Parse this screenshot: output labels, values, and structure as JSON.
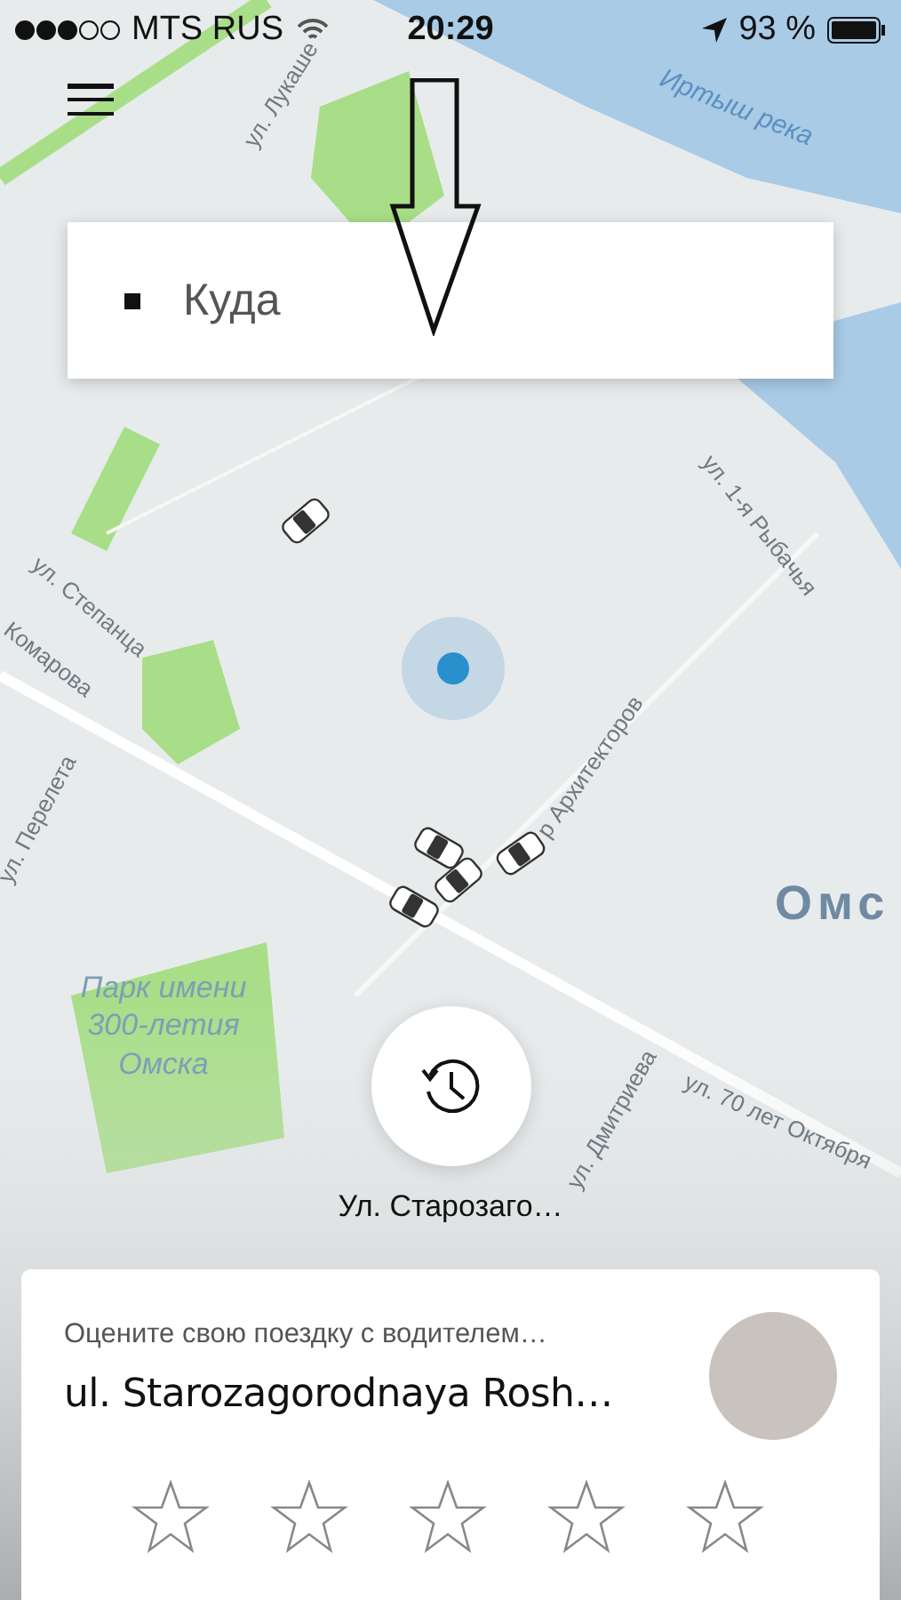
{
  "status_bar": {
    "carrier": "MTS RUS",
    "time": "20:29",
    "battery": "93 %"
  },
  "map": {
    "labels": [
      {
        "text": "ул. Лукаше",
        "kind": "street"
      },
      {
        "text": "Иртыш река",
        "kind": "water"
      },
      {
        "text": "ул. 1-я Рыбачья",
        "kind": "street"
      },
      {
        "text": "ул. Степанца",
        "kind": "street"
      },
      {
        "text": "Комарова",
        "kind": "street"
      },
      {
        "text": "ул. Перелета",
        "kind": "street"
      },
      {
        "text": "р Архитекторов",
        "kind": "street"
      },
      {
        "text": "Омс",
        "kind": "city"
      },
      {
        "text": "Парк имени 300-летия Омска",
        "kind": "park"
      },
      {
        "text": "ул. 70 лет Октября",
        "kind": "street"
      },
      {
        "text": "ул. Дмитриева",
        "kind": "street"
      }
    ]
  },
  "search": {
    "label": "Куда"
  },
  "recent_place": {
    "label": "Ул. Старозаго…"
  },
  "rating_card": {
    "prompt": "Оцените свою поездку с водителем…",
    "address": "ul. Starozagorodnaya Rosh…",
    "stars": 0
  }
}
